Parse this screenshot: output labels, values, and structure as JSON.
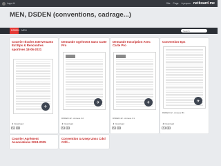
{
  "topbar": {
    "user_label": "Logo 44",
    "right_items": [
      "Site",
      "Page",
      "A propos"
    ],
    "brand_main": "netboard",
    "brand_dot": ".",
    "brand_tld": "me"
  },
  "page": {
    "title": "MEN, DSDEN (conventions, cadrage...)"
  },
  "tabs": [
    {
      "label": "DSDEN",
      "active": true
    },
    {
      "label": "MEN",
      "active": false
    }
  ],
  "search": {
    "placeholder": "Search"
  },
  "cards": [
    {
      "title": "Courrier Écoles Intervenants Ext Eps & Rencontres sportives 18-06-2021",
      "caption": "",
      "download": "Download"
    },
    {
      "title": "Demande Agrément Sans Carte Pro",
      "caption": "DSDEN 42 - Annexe C2",
      "download": "Download"
    },
    {
      "title": "Demande Inscription Avec Carte Pro",
      "caption": "DSDEN 42 - Annexe C1",
      "download": "Download"
    },
    {
      "title": "Convention Eps",
      "caption": "DSDEN 42 - Annexe B1",
      "download": "Download"
    },
    {
      "title": "Courrier Agrément Associations 2024-2025",
      "caption": "",
      "download": ""
    },
    {
      "title": "Convention Ia Usep Unss Cdsl Cdtl...",
      "caption": "",
      "download": ""
    }
  ],
  "icons": {
    "user": "user-avatar-icon",
    "download": "download-icon",
    "badge": "share-badge-icon",
    "actions": [
      "edit-icon",
      "link-icon"
    ]
  }
}
